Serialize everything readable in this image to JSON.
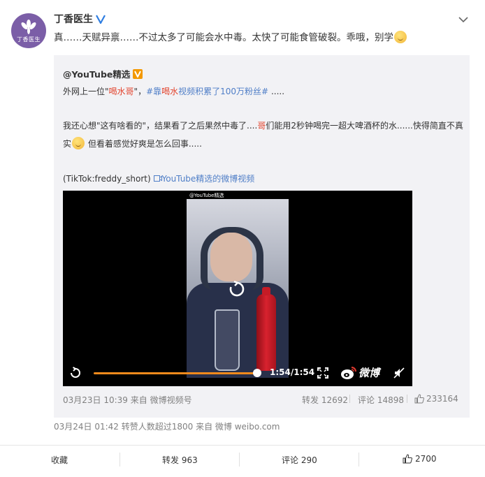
{
  "post": {
    "author_name": "丁香医生",
    "avatar_label": "丁香医生",
    "text": "真……天赋异禀……不过太多了可能会水中毒。太快了可能食管破裂。乖哦，别学"
  },
  "repost": {
    "author": "@YouTube精选",
    "line1_a": "外网上一位\"",
    "line1_red": "喝水哥",
    "line1_b": "\"，",
    "line1_tag1": "#靠",
    "line1_tag_red": "喝水",
    "line1_tag2": "视频积累了100万粉丝#",
    "line1_c": " .....",
    "line2_a": "我还心想\"这有啥看的\"，结果看了之后果然中毒了....",
    "line2_red": "哥",
    "line2_b": "们能用2秒钟喝完一超大啤酒杯的水......快得简直不真",
    "line3_a": "实",
    "line3_b": " 但看着感觉好爽是怎么回事.....",
    "source_text": "(TikTok:freddy_short) ",
    "video_link": "YouTube精选的微博视频",
    "video": {
      "watermark": "@YouTube精选",
      "time": "1:54/1:54",
      "progress": 1.0,
      "logo_text": "微博"
    },
    "meta": "03月23日 10:39 来自 微博视频号",
    "reposts": "转发 12692",
    "comments": "评论 14898",
    "likes": "233164"
  },
  "time_line": "03月24日 01:42 转赞人数超过1800 来自 微博 weibo.com",
  "actions": {
    "favorite": "收藏",
    "repost": "转发 963",
    "comment": "评论 290",
    "like": "2700"
  },
  "colors": {
    "accent_blue": "#4f7ec7",
    "highlight_red": "#e3452f",
    "progress_orange": "#f08a1c",
    "avatar_purple": "#7b5ea7"
  }
}
